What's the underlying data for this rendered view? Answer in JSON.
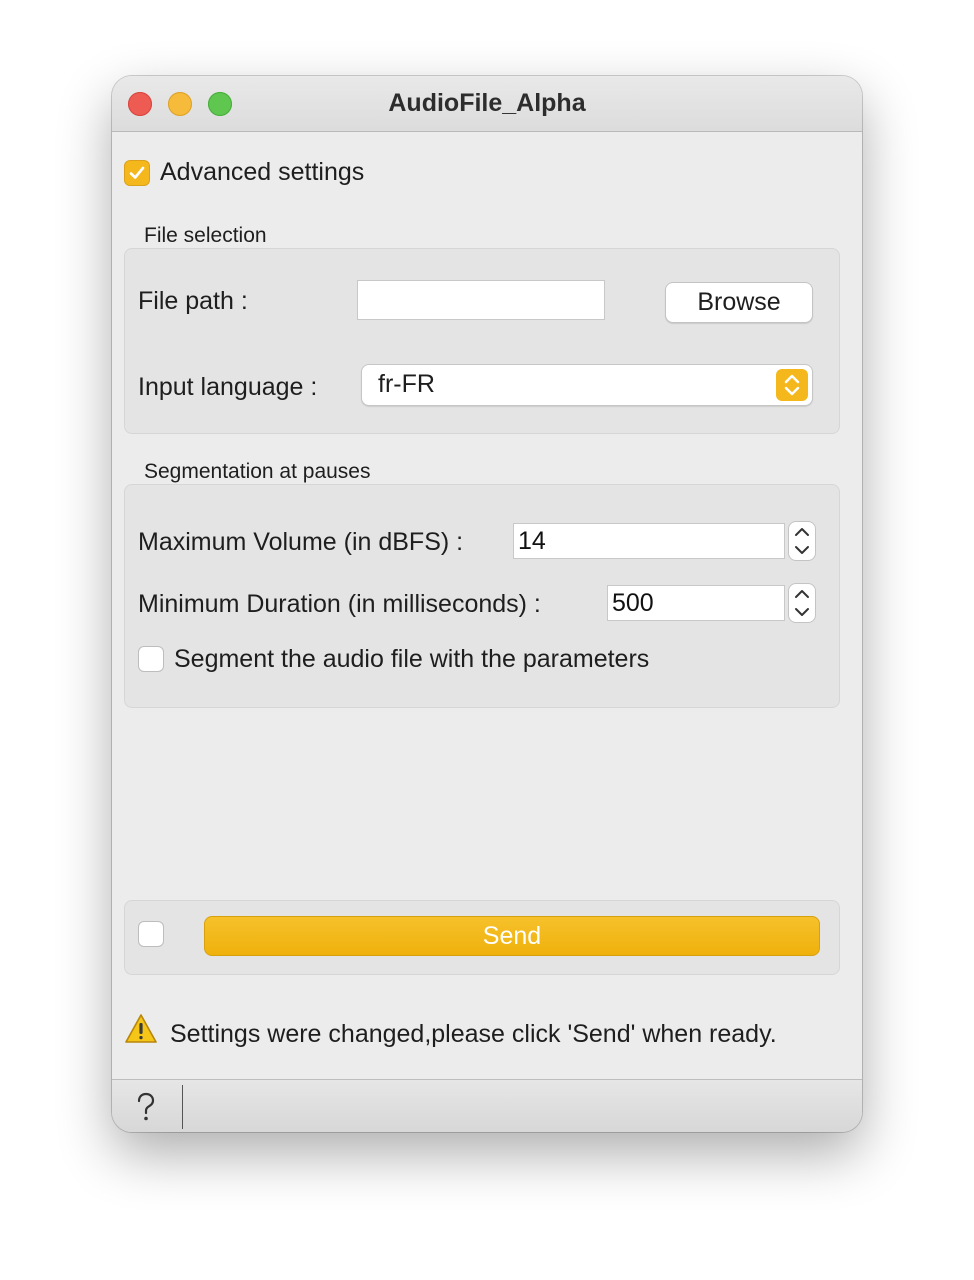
{
  "window": {
    "title": "AudioFile_Alpha"
  },
  "advanced_settings": {
    "label": "Advanced settings",
    "checked": true
  },
  "file_selection": {
    "title": "File selection",
    "file_path_label": "File path :",
    "file_path_value": "",
    "browse_label": "Browse",
    "input_language_label": "Input language :",
    "input_language_value": "fr-FR"
  },
  "segmentation": {
    "title": "Segmentation at pauses",
    "max_volume_label": "Maximum Volume (in dBFS) :",
    "max_volume_value": "14",
    "min_duration_label": "Minimum Duration (in milliseconds) :",
    "min_duration_value": "500",
    "segment_label": "Segment the audio file with the parameters",
    "segment_checked": false
  },
  "send": {
    "label": "Send",
    "auto_send_checked": false
  },
  "status": {
    "message": "Settings were changed,please click 'Send' when ready."
  },
  "footer": {
    "help_icon": "question-mark-icon"
  },
  "colors": {
    "accent": "#f5b81c",
    "close": "#ee5b53",
    "minimize": "#f6bb3a",
    "maximize": "#5fc650"
  }
}
